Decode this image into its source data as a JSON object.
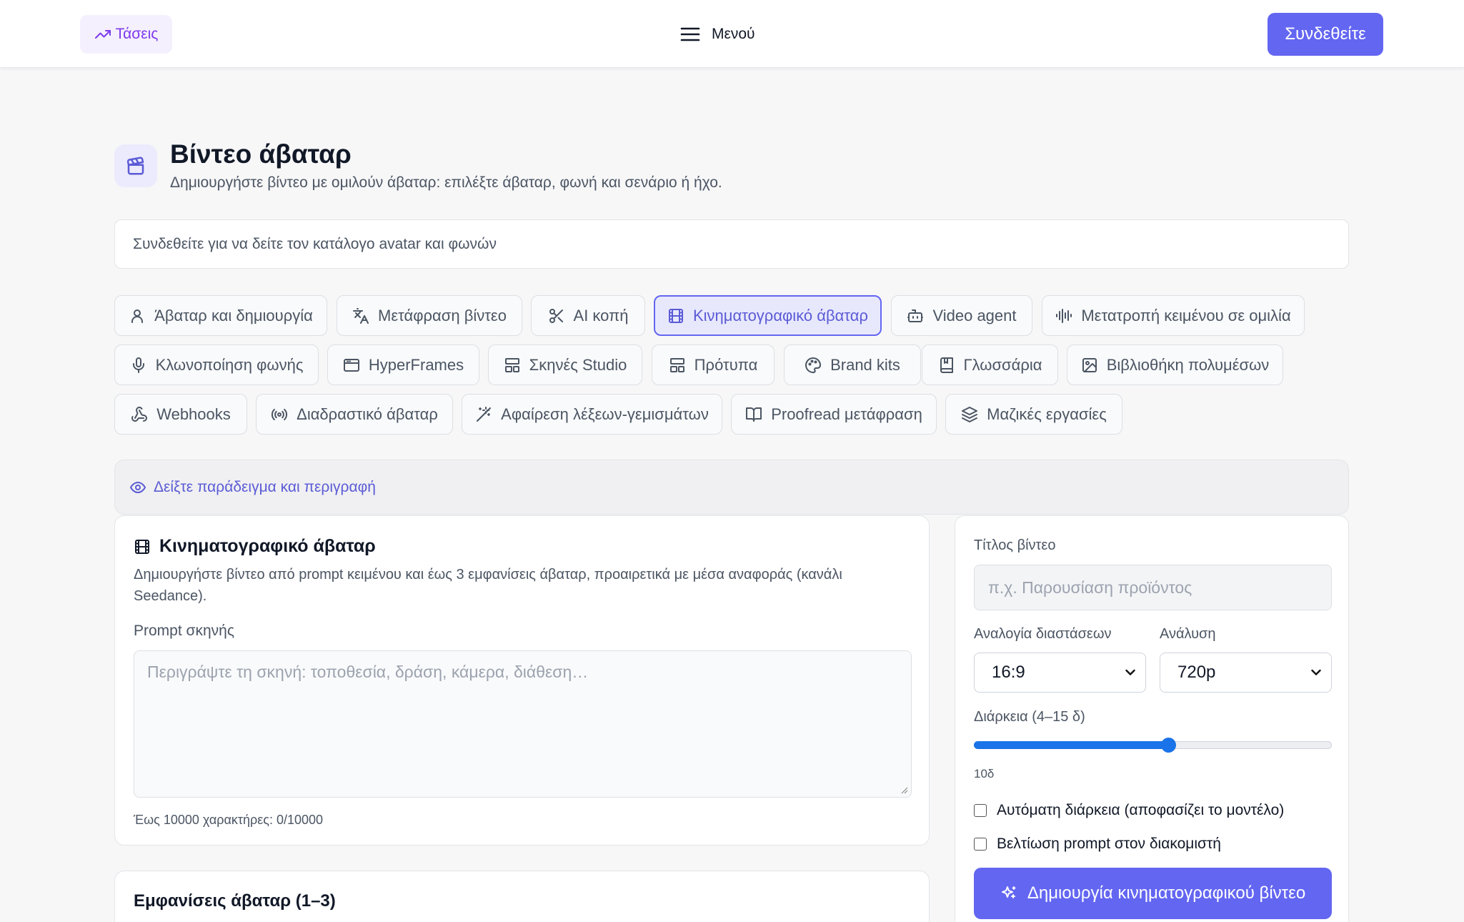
{
  "header": {
    "trends_label": "Τάσεις",
    "menu_label": "Μενού",
    "login_label": "Συνδεθείτε"
  },
  "page": {
    "title": "Βίντεο άβαταρ",
    "subtitle": "Δημιουργήστε βίντεο με ομιλούν άβαταρ: επιλέξτε άβαταρ, φωνή και σενάριο ή ήχο.",
    "login_notice": "Συνδεθείτε για να δείτε τον κατάλογο avatar και φωνών"
  },
  "tabs": [
    {
      "label": "Άβαταρ και δημιουργία",
      "icon": "user-icon"
    },
    {
      "label": "Μετάφραση βίντεο",
      "icon": "translate-icon"
    },
    {
      "label": "AI κοπή",
      "icon": "scissors-icon"
    },
    {
      "label": "Κινηματογραφικό άβαταρ",
      "icon": "film-icon",
      "active": true
    },
    {
      "label": "Video agent",
      "icon": "robot-icon"
    },
    {
      "label": "Μετατροπή κειμένου σε ομιλία",
      "icon": "audio-waveform-icon"
    },
    {
      "label": "Κλωνοποίηση φωνής",
      "icon": "microphone-icon"
    },
    {
      "label": "HyperFrames",
      "icon": "browser-window-icon"
    },
    {
      "label": "Σκηνές Studio",
      "icon": "layout-icon"
    },
    {
      "label": "Πρότυπα",
      "icon": "template-icon"
    },
    {
      "label": "Brand kits",
      "icon": "palette-icon"
    },
    {
      "label": "Γλωσσάρια",
      "icon": "book-icon"
    },
    {
      "label": "Βιβλιοθήκη πολυμέσων",
      "icon": "image-icon"
    },
    {
      "label": "Webhooks",
      "icon": "webhook-icon"
    },
    {
      "label": "Διαδραστικό άβαταρ",
      "icon": "broadcast-icon"
    },
    {
      "label": "Αφαίρεση λέξεων-γεμισμάτων",
      "icon": "magic-wand-icon"
    },
    {
      "label": "Proofread μετάφραση",
      "icon": "open-book-icon"
    },
    {
      "label": "Μαζικές εργασίες",
      "icon": "layers-icon"
    }
  ],
  "example_toggle": "Δείξτε παράδειγμα και περιγραφή",
  "cinematic_card": {
    "title": "Κινηματογραφικό άβαταρ",
    "description": "Δημιουργήστε βίντεο από prompt κειμένου και έως 3 εμφανίσεις άβαταρ, προαιρετικά με μέσα αναφοράς (κανάλι Seedance).",
    "prompt_label": "Prompt σκηνής",
    "prompt_placeholder": "Περιγράψτε τη σκηνή: τοποθεσία, δράση, κάμερα, διάθεση…",
    "char_counter": "Έως 10000 χαρακτήρες: 0/10000"
  },
  "appearances_card": {
    "title": "Εμφανίσεις άβαταρ (1–3)"
  },
  "settings": {
    "video_title_label": "Τίτλος βίντεο",
    "video_title_placeholder": "π.χ. Παρουσίαση προϊόντος",
    "aspect_label": "Αναλογία διαστάσεων",
    "aspect_value": "16:9",
    "resolution_label": "Ανάλυση",
    "resolution_value": "720p",
    "duration_label": "Διάρκεια (4–15 δ)",
    "duration_min": 4,
    "duration_max": 15,
    "duration_current": 10,
    "duration_value": "10δ",
    "auto_duration_label": "Αυτόματη διάρκεια (αποφασίζει το μοντέλο)",
    "auto_duration_checked": false,
    "enhance_prompt_label": "Βελτίωση prompt στον διακομιστή",
    "enhance_prompt_checked": false,
    "generate_label": "Δημιουργία κινηματογραφικού βίντεο"
  },
  "colors": {
    "accent": "#6366f1",
    "slider": "#1a73e8",
    "trends": "#7c3aed"
  }
}
